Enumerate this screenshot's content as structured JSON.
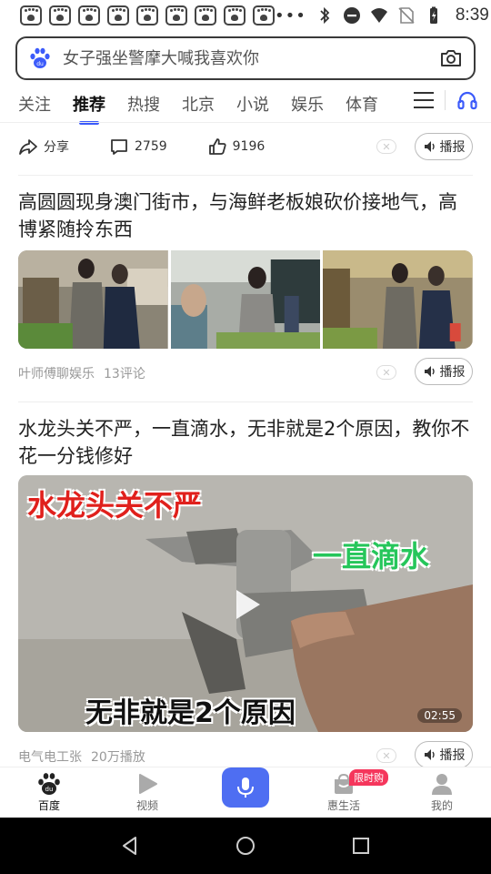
{
  "status_bar": {
    "time": "8:39",
    "notification_icons": [
      "baidu-paw-icon",
      "baidu-paw-icon",
      "baidu-paw-icon",
      "baidu-paw-icon",
      "baidu-paw-icon",
      "baidu-paw-icon",
      "baidu-paw-icon",
      "baidu-paw-icon",
      "baidu-paw-icon"
    ],
    "overflow": "•••"
  },
  "search": {
    "placeholder": "女子强坐警摩大喊我喜欢你"
  },
  "tabs": [
    {
      "label": "关注",
      "active": false
    },
    {
      "label": "推荐",
      "active": true
    },
    {
      "label": "热搜",
      "active": false
    },
    {
      "label": "北京",
      "active": false
    },
    {
      "label": "小说",
      "active": false
    },
    {
      "label": "娱乐",
      "active": false
    },
    {
      "label": "体育",
      "active": false
    }
  ],
  "action_row": {
    "share_label": "分享",
    "comments": "2759",
    "likes": "9196",
    "broadcast_label": "播报"
  },
  "news": [
    {
      "title": "高圆圆现身澳门街市，与海鲜老板娘砍价接地气，高博紧随拎东西",
      "source": "叶师傅聊娱乐",
      "stats": "13评论",
      "broadcast_label": "播报"
    },
    {
      "title": "水龙头关不严，一直滴水，无非就是2个原因，教你不花一分钱修好",
      "source": "电气电工张",
      "stats": "20万播放",
      "broadcast_label": "播报",
      "video": {
        "overlay_top": "水龙头关不严",
        "overlay_right": "一直滴水",
        "overlay_bottom": "无非就是2个原因",
        "duration": "02:55"
      }
    }
  ],
  "bottom_nav": {
    "items": [
      {
        "label": "百度",
        "icon": "baidu-paw-icon"
      },
      {
        "label": "视频",
        "icon": "video-play-icon"
      },
      {
        "label": "",
        "icon": "microphone-icon"
      },
      {
        "label": "惠生活",
        "icon": "shopping-bag-icon",
        "badge": "限时购"
      },
      {
        "label": "我的",
        "icon": "user-icon"
      }
    ]
  },
  "colors": {
    "accent": "#4e6ef2",
    "tab_indicator": "#3c5bfa",
    "badge": "#f5365c"
  }
}
